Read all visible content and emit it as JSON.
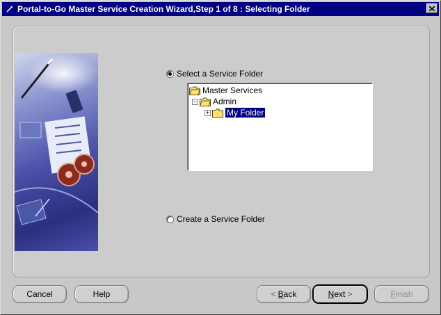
{
  "window": {
    "title": "Portal-to-Go Master Service Creation Wizard,Step 1 of 8 : Selecting Folder"
  },
  "options": {
    "select_folder_label": "Select a Service Folder",
    "create_folder_label": "Create a Service Folder",
    "selected": "select"
  },
  "tree": {
    "root_label": "Master Services",
    "admin_label": "Admin",
    "my_folder_label": "My Folder"
  },
  "buttons": {
    "cancel": "Cancel",
    "help": "Help",
    "back_mnemonic": "B",
    "back_rest": "ack",
    "next_mnemonic": "N",
    "next_rest": "ext",
    "finish_mnemonic": "F",
    "finish_rest": "inish"
  },
  "colors": {
    "titlebar": "#000080",
    "selection": "#000080",
    "panel": "#cccccc"
  }
}
